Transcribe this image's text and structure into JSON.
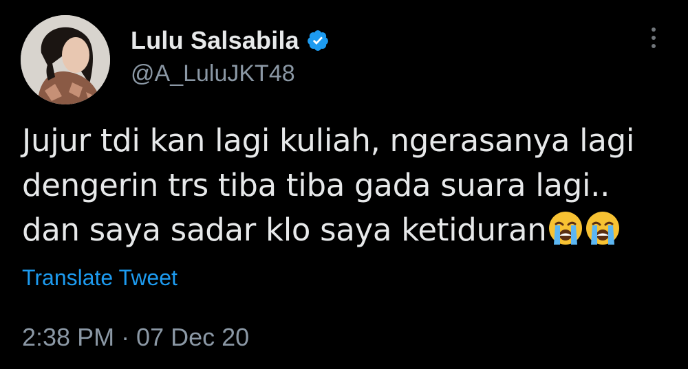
{
  "author": {
    "display_name": "Lulu Salsabila",
    "handle": "@A_LuluJKT48",
    "verified": true
  },
  "tweet": {
    "lines": [
      "Jujur tdi kan lagi kuliah, ngerasanya lagi",
      "dengerin trs tiba tiba gada suara lagi..",
      "dan saya sadar klo saya ketiduran"
    ],
    "emojis": [
      "loudly-crying-face",
      "loudly-crying-face"
    ]
  },
  "actions": {
    "translate_label": "Translate Tweet"
  },
  "meta": {
    "timestamp": "2:38 PM · 07 Dec 20"
  },
  "colors": {
    "background": "#000000",
    "text": "#e7e9ea",
    "secondary": "#8b98a5",
    "link": "#1d9bf0",
    "verified_badge": "#1d9bf0"
  }
}
